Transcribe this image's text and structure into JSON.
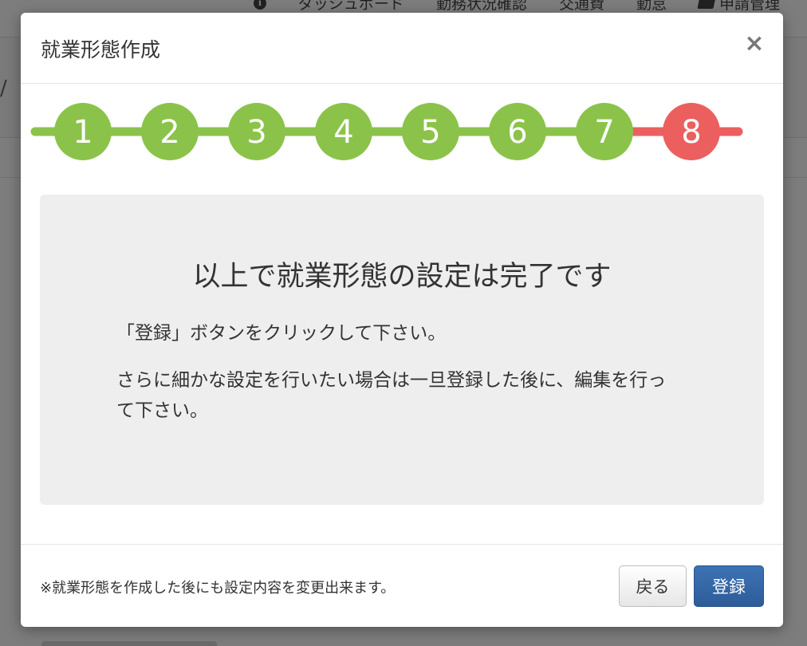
{
  "background": {
    "nav": {
      "info_icon": "info-icon",
      "items": [
        "ダッシュボード",
        "勤務状況確認",
        "交通費",
        "勤怠"
      ],
      "last_item": "申請管理",
      "last_item_icon": "folder-icon"
    },
    "breadcrumb_separator": "/"
  },
  "modal": {
    "title": "就業形態作成",
    "close_label": "×",
    "stepper": {
      "steps": [
        "1",
        "2",
        "3",
        "4",
        "5",
        "6",
        "7",
        "8"
      ],
      "current_step": "8",
      "completed_color": "#8bc34a",
      "current_color": "#ec5f5f"
    },
    "panel": {
      "heading": "以上で就業形態の設定は完了です",
      "line1": "「登録」ボタンをクリックして下さい。",
      "line2": "さらに細かな設定を行いたい場合は一旦登録した後に、編集を行って下さい。"
    },
    "footer": {
      "note": "※就業形態を作成した後にも設定内容を変更出来ます。",
      "back_label": "戻る",
      "register_label": "登録",
      "register_color": "#3466a6"
    }
  }
}
